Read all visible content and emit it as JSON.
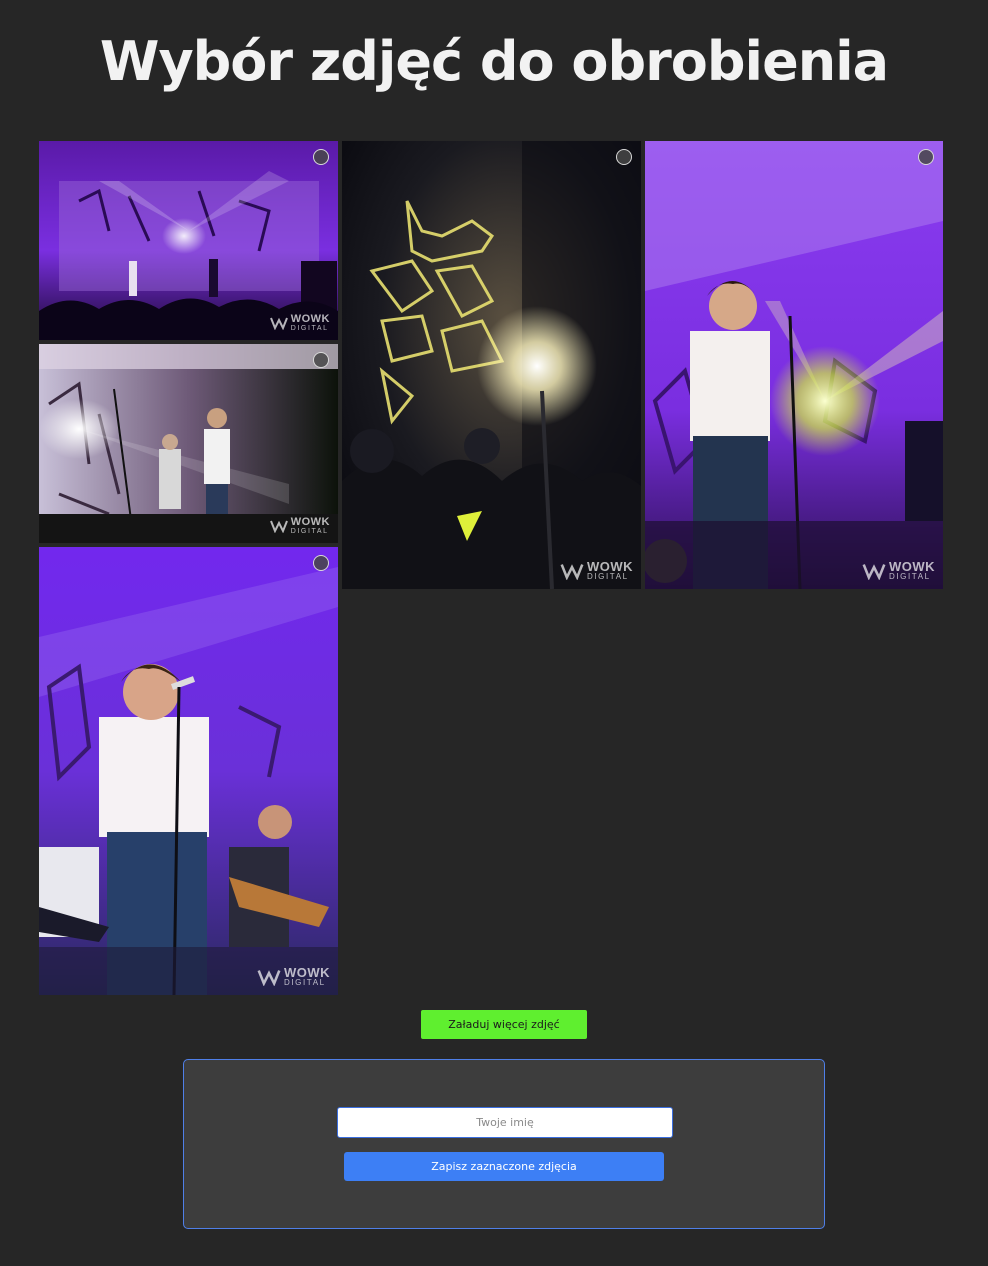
{
  "page": {
    "title": "Wybór zdjęć do obrobienia"
  },
  "photos": [
    {
      "scene": "band performing on purple-lit stage with audience silhouettes",
      "selected": false
    },
    {
      "scene": "spotlight projecting a yellow pattern over the crowd",
      "selected": false
    },
    {
      "scene": "singer with microphone stand under purple light",
      "selected": false
    },
    {
      "scene": "singer and guitarist on stage with light beams",
      "selected": false
    },
    {
      "scene": "singer shouting into microphone with guitarists behind",
      "selected": false
    }
  ],
  "watermark": {
    "main": "WOWK",
    "sub": "DIGITAL",
    "icon": "wowk-logo-icon"
  },
  "load_more": {
    "label": "Załaduj więcej zdjęć"
  },
  "form": {
    "name_placeholder": "Twoje imię",
    "name_value": "",
    "save_label": "Zapisz zaznaczone zdjęcia"
  },
  "colors": {
    "background": "#262626",
    "accent_green": "#5fef2f",
    "accent_blue": "#3d7ff5",
    "panel": "#3d3d3d"
  }
}
